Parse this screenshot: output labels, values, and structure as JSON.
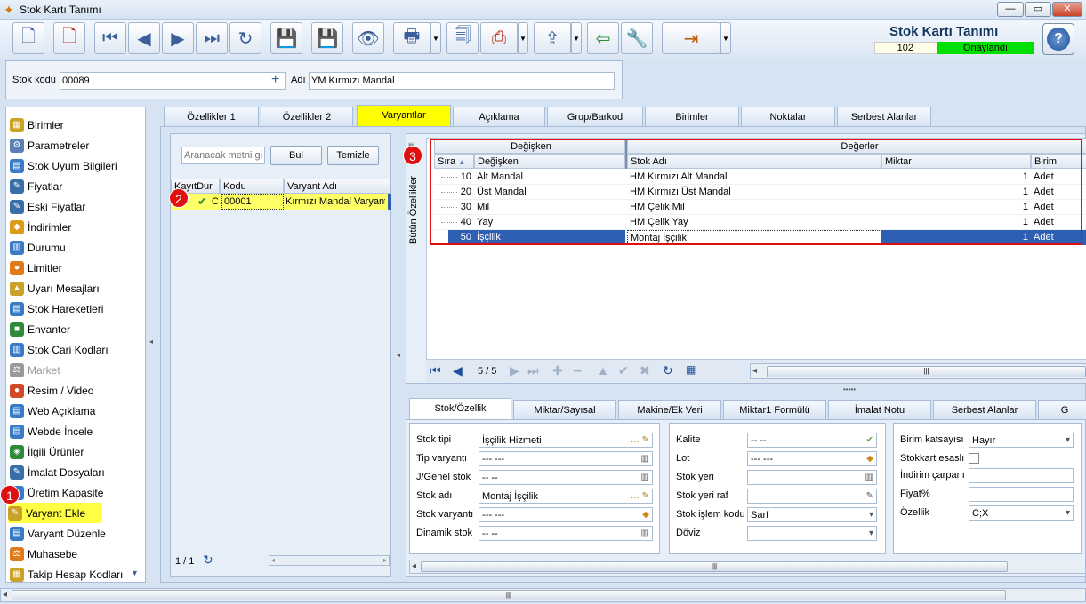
{
  "window": {
    "title": "Stok Kartı Tanımı",
    "app_title": "Stok Kartı Tanımı",
    "number": "102",
    "status": "Onaylandı",
    "help": "?"
  },
  "header": {
    "stok_kodu_label": "Stok kodu",
    "stok_kodu": "00089",
    "adi_label": "Adı",
    "adi": "YM Kırmızı Mandal"
  },
  "nav": {
    "items": [
      "Birimler",
      "Parametreler",
      "Stok Uyum Bilgileri",
      "Fiyatlar",
      "Eski Fiyatlar",
      "İndirimler",
      "Durumu",
      "Limitler",
      "Uyarı Mesajları",
      "Stok Hareketleri",
      "Envanter",
      "Stok Cari Kodları",
      "Market",
      "Resim / Video",
      "Web Açıklama",
      "Webde İncele",
      "İlgili Ürünler",
      "İmalat Dosyaları",
      "Üretim Kapasite",
      "Varyant Ekle",
      "Varyant Düzenle",
      "Muhasebe",
      "Takip Hesap Kodları"
    ]
  },
  "tabs": [
    "Özellikler 1",
    "Özellikler 2",
    "Varyantlar",
    "Açıklama",
    "Grup/Barkod",
    "Birimler",
    "Noktalar",
    "Serbest Alanlar"
  ],
  "variants": {
    "search_placeholder": "Aranacak metni gir",
    "find_btn": "Bul",
    "clear_btn": "Temizle",
    "cols": [
      "KayıtDur",
      "Kodu",
      "Varyant Adı"
    ],
    "row": {
      "status": "C",
      "code": "00001",
      "name": "Kırmızı Mandal Varyantı"
    },
    "pager": "1 / 1"
  },
  "grid": {
    "side_label": "Bütün Özellikler",
    "group_left": "Değişken",
    "group_right": "Değerler",
    "cols": [
      "Sıra",
      "Değişken",
      "Stok Adı",
      "Miktar",
      "Birim"
    ],
    "rows": [
      {
        "sira": "10",
        "degisken": "Alt Mandal",
        "stok": "HM Kırmızı Alt Mandal",
        "miktar": "1",
        "birim": "Adet"
      },
      {
        "sira": "20",
        "degisken": "Üst Mandal",
        "stok": "HM Kırmızı Üst Mandal",
        "miktar": "1",
        "birim": "Adet"
      },
      {
        "sira": "30",
        "degisken": "Mil",
        "stok": "HM Çelik Mil",
        "miktar": "1",
        "birim": "Adet"
      },
      {
        "sira": "40",
        "degisken": "Yay",
        "stok": "HM Çelik Yay",
        "miktar": "1",
        "birim": "Adet"
      },
      {
        "sira": "50",
        "degisken": "İşçilik",
        "stok": "Montaj İşçilik",
        "miktar": "1",
        "birim": "Adet"
      }
    ],
    "pager": "5 / 5"
  },
  "bottom_tabs": [
    "Stok/Özellik",
    "Miktar/Sayısal",
    "Makine/Ek Veri",
    "Miktar1 Formülü",
    "İmalat Notu",
    "Serbest Alanlar",
    "G"
  ],
  "form1": {
    "labels": [
      "Stok tipi",
      "Tip varyantı",
      "J/Genel stok",
      "Stok adı",
      "Stok varyantı",
      "Dinamik stok"
    ],
    "values": [
      "İşçilik Hizmeti",
      "--- ---",
      "-- --",
      "Montaj İşçilik",
      "--- ---",
      "-- --"
    ]
  },
  "form2": {
    "labels": [
      "Kalite",
      "Lot",
      "Stok yeri",
      "Stok yeri raf",
      "Stok işlem kodu",
      "Döviz"
    ],
    "values": [
      "-- --",
      "--- ---",
      "",
      "",
      "Sarf",
      ""
    ]
  },
  "form3": {
    "labels": [
      "Birim katsayısı",
      "Stokkart esaslı",
      "İndirim çarpanı",
      "Fiyat%",
      "Özellik"
    ],
    "values": [
      "Hayır",
      "",
      "",
      "",
      "C;X"
    ]
  },
  "markers": [
    "1",
    "2",
    "3"
  ],
  "colors": {
    "highlight": "#ffff00",
    "selected_row": "#2f5fb3",
    "status_ok": "#00e000",
    "annotation": "#e01010"
  }
}
